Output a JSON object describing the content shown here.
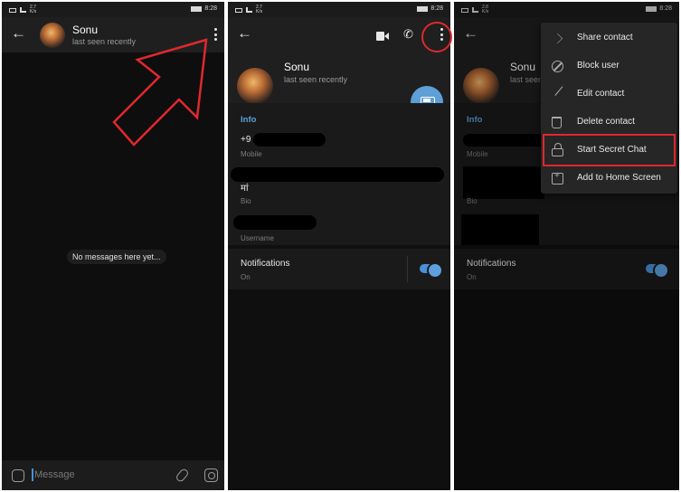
{
  "status_bar": {
    "speed_1": "2.7",
    "speed_2": "2.7",
    "speed_3": "2.8",
    "speed_unit": "K/s",
    "time": "8:28"
  },
  "contact": {
    "name": "Sonu",
    "last_seen": "last seen recently"
  },
  "chat": {
    "empty_text": "No messages here yet...",
    "message_placeholder": "Message"
  },
  "profile": {
    "info_title": "Info",
    "phone_partial": "+9",
    "mobile_label": "Mobile",
    "bio_partial": "मां",
    "bio_label": "Bio",
    "username_label": "Username",
    "notifications_title": "Notifications",
    "notifications_status": "On",
    "notifications_enabled": true
  },
  "menu": {
    "items": [
      {
        "label": "Share contact",
        "icon": "share-icon"
      },
      {
        "label": "Block user",
        "icon": "block-icon"
      },
      {
        "label": "Edit contact",
        "icon": "edit-icon"
      },
      {
        "label": "Delete contact",
        "icon": "delete-icon"
      },
      {
        "label": "Start Secret Chat",
        "icon": "lock-icon"
      },
      {
        "label": "Add to Home Screen",
        "icon": "add-home-icon"
      }
    ]
  },
  "colors": {
    "accent": "#5d9fd6",
    "annotation": "#e0282d",
    "background": "#0f0f0f"
  }
}
